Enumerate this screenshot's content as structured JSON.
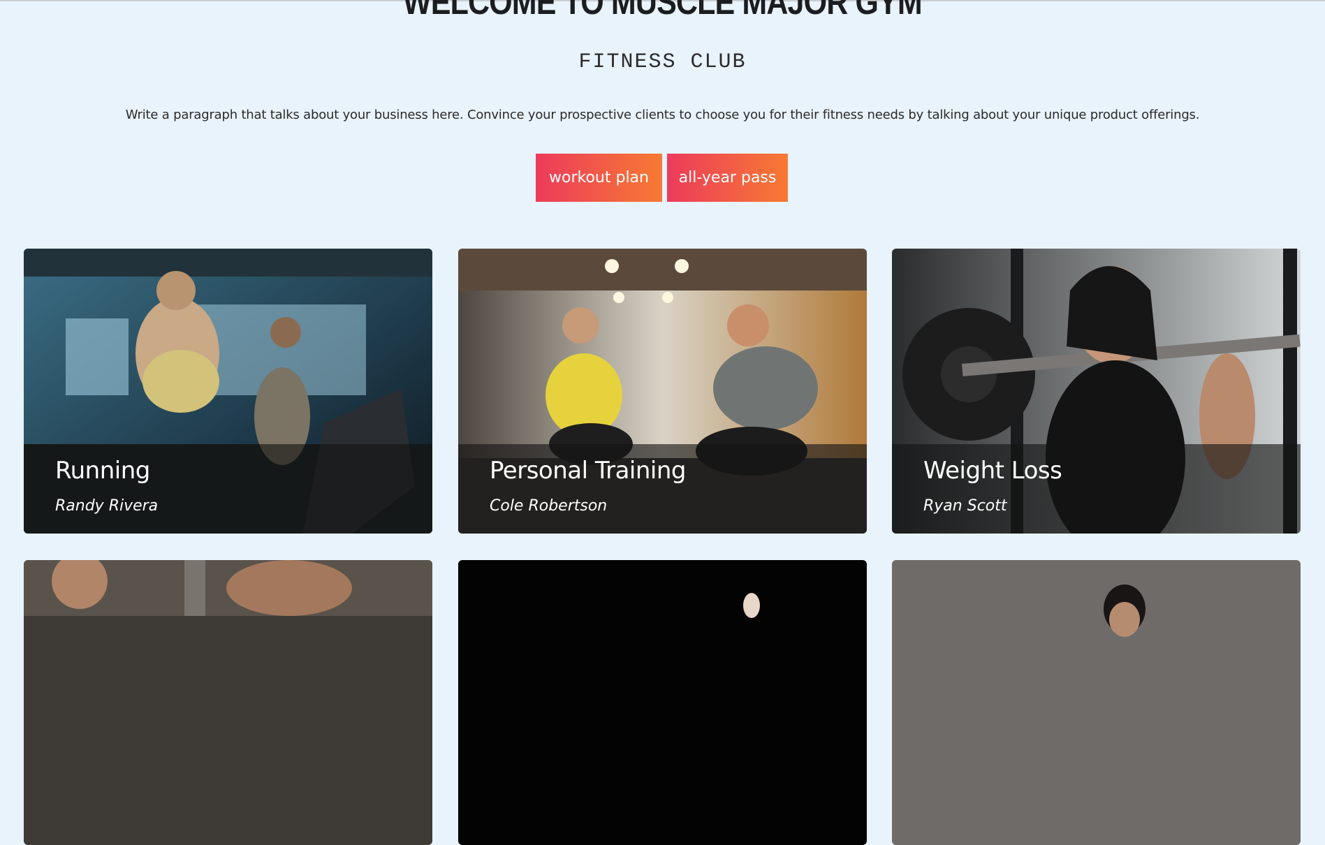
{
  "header": {
    "title": "WELCOME TO MUSCLE MAJOR GYM",
    "subtitle": "FITNESS CLUB",
    "paragraph": "Write a paragraph that talks about your business here. Convince your prospective clients to choose you for their fitness needs by talking about your unique product offerings."
  },
  "buttons": {
    "workout_plan": "workout plan",
    "all_year_pass": "all-year pass"
  },
  "colors": {
    "background": "#e9f3fb",
    "button_gradient_start": "#ec3b5b",
    "button_gradient_end": "#f77a33"
  },
  "cards": [
    {
      "title": "Running",
      "trainer": "Randy Rivera",
      "image": "running-photo"
    },
    {
      "title": "Personal Training",
      "trainer": "Cole Robertson",
      "image": "personal-training-photo"
    },
    {
      "title": "Weight Loss",
      "trainer": "Ryan Scott",
      "image": "weight-loss-photo"
    },
    {
      "image": "fitness-photo"
    },
    {
      "image": "fitness-photo"
    },
    {
      "image": "fitness-photo"
    }
  ]
}
